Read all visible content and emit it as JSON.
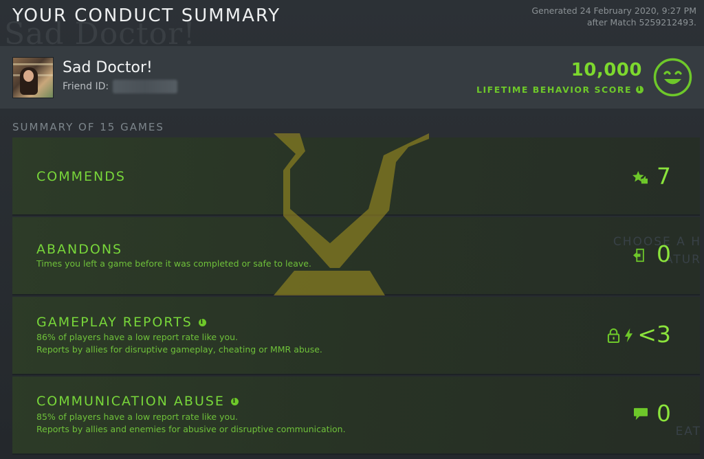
{
  "header": {
    "title": "YOUR CONDUCT SUMMARY",
    "generated_line1": "Generated 24 February 2020, 9:27 PM",
    "generated_line2": "after Match 5259212493."
  },
  "profile": {
    "name": "Sad Doctor!",
    "friend_id_label": "Friend ID:",
    "score": "10,000",
    "score_label": "LIFETIME BEHAVIOR SCORE"
  },
  "summary": {
    "label": "SUMMARY OF 15 GAMES",
    "rows": [
      {
        "title": "COMMENDS",
        "desc1": "",
        "desc2": "",
        "value": "7",
        "icon": "star-thumbs-up-icon"
      },
      {
        "title": "ABANDONS",
        "desc1": "Times you left a game before it was completed or safe to leave.",
        "desc2": "",
        "value": "0",
        "icon": "exit-door-icon"
      },
      {
        "title": "GAMEPLAY REPORTS",
        "desc1": "86% of players have a low report rate like you.",
        "desc2": "Reports by allies for disruptive gameplay, cheating or MMR abuse.",
        "value": "<3",
        "icon": "lock-lightning-icon"
      },
      {
        "title": "COMMUNICATION ABUSE",
        "desc1": "85% of players have a low report rate like you.",
        "desc2": "Reports by allies and enemies for abusive or disruptive communication.",
        "value": "0",
        "icon": "chat-bubble-icon"
      }
    ]
  },
  "colors": {
    "accent_green": "#7dd82e",
    "gold_watermark": "#b5a21e",
    "background": "#2a2f33"
  }
}
